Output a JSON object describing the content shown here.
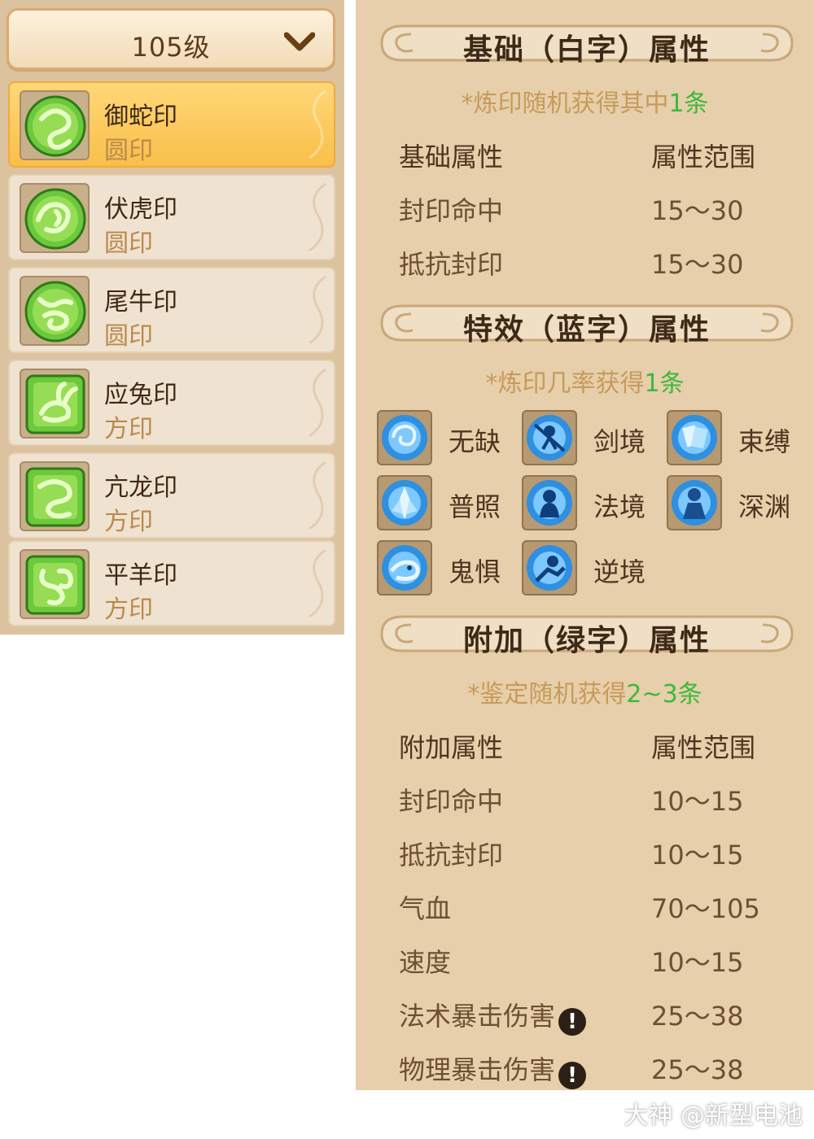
{
  "dropdown": {
    "level": "105级"
  },
  "seals": [
    {
      "name": "御蛇印",
      "type": "圆印",
      "selected": true
    },
    {
      "name": "伏虎印",
      "type": "圆印",
      "selected": false
    },
    {
      "name": "尾牛印",
      "type": "圆印",
      "selected": false
    },
    {
      "name": "应兔印",
      "type": "方印",
      "selected": false
    },
    {
      "name": "亢龙印",
      "type": "方印",
      "selected": false
    },
    {
      "name": "平羊印",
      "type": "方印",
      "selected": false
    }
  ],
  "base": {
    "title": "基础（白字）属性",
    "note_prefix": "*炼印随机获得其中",
    "note_count": "1条",
    "header_key": "基础属性",
    "header_value": "属性范围",
    "rows": [
      {
        "key": "封印命中",
        "value": "15～30"
      },
      {
        "key": "抵抗封印",
        "value": "15～30"
      }
    ]
  },
  "special": {
    "title": "特效（蓝字）属性",
    "note_prefix": "*炼印几率获得",
    "note_count": "1条",
    "effects": [
      {
        "label": "无缺",
        "icon": "swirl-icon"
      },
      {
        "label": "剑境",
        "icon": "sword-figure-icon"
      },
      {
        "label": "束缚",
        "icon": "bind-cards-icon"
      },
      {
        "label": "普照",
        "icon": "crystal-icon"
      },
      {
        "label": "法境",
        "icon": "spirit-figure-icon"
      },
      {
        "label": "深渊",
        "icon": "abyss-figure-icon"
      },
      {
        "label": "鬼惧",
        "icon": "ghost-icon"
      },
      {
        "label": "逆境",
        "icon": "dash-figure-icon"
      }
    ]
  },
  "extra": {
    "title": "附加（绿字）属性",
    "note_prefix": "*鉴定随机获得",
    "note_count": "2~3条",
    "header_key": "附加属性",
    "header_value": "属性范围",
    "rows": [
      {
        "key": "封印命中",
        "value": "10～15",
        "warn": false
      },
      {
        "key": "抵抗封印",
        "value": "10～15",
        "warn": false
      },
      {
        "key": "气血",
        "value": "70～105",
        "warn": false
      },
      {
        "key": "速度",
        "value": "10～15",
        "warn": false
      },
      {
        "key": "法术暴击伤害",
        "value": "25～38",
        "warn": true
      },
      {
        "key": "物理暴击伤害",
        "value": "25～38",
        "warn": true
      }
    ]
  },
  "warn_symbol": "!",
  "watermark": "大神 @新型电池",
  "colors": {
    "accent_green": "#3cb93c",
    "selected_item": "#f9bf4a",
    "panel": "#e6cfaa"
  }
}
